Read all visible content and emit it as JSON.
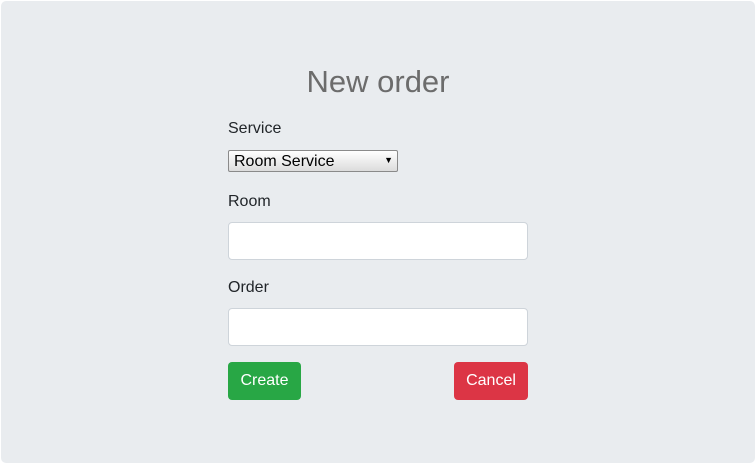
{
  "form": {
    "title": "New order",
    "service_label": "Service",
    "service_value": "Room Service",
    "service_arrow": "▼",
    "room_label": "Room",
    "room_value": "",
    "order_label": "Order",
    "order_value": "",
    "create_label": "Create",
    "cancel_label": "Cancel"
  },
  "colors": {
    "panel_bg": "#e9ecef",
    "create_button": "#28a745",
    "cancel_button": "#dc3545"
  }
}
